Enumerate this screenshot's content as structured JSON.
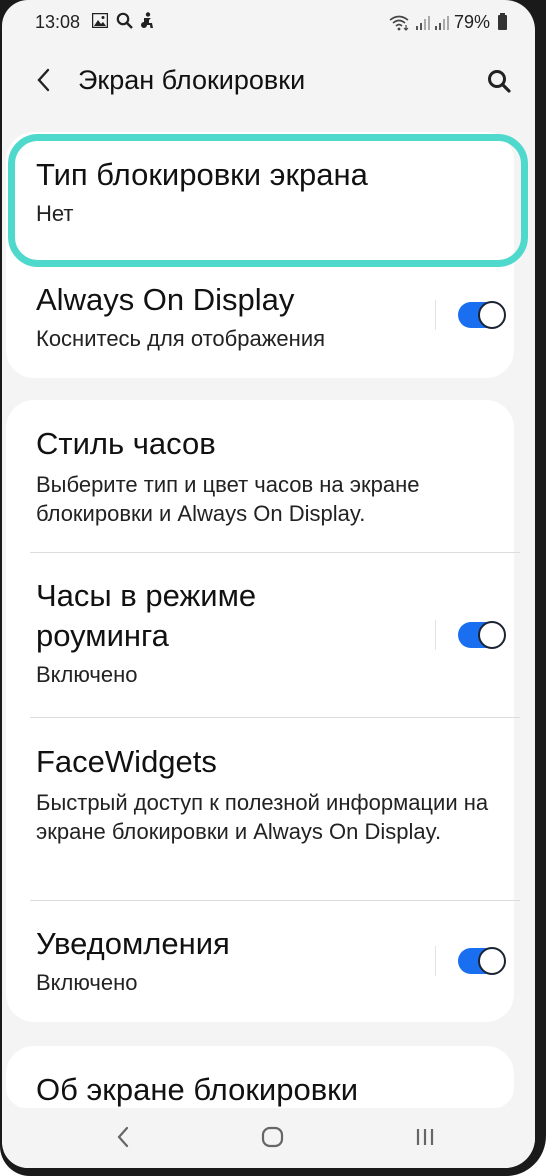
{
  "status_bar": {
    "time": "13:08",
    "left_icons": [
      "gallery-icon",
      "search-icon",
      "accessibility-icon"
    ],
    "right_icons": [
      "wifi-icon",
      "signal-icon",
      "signal-icon"
    ],
    "battery": "79%"
  },
  "header": {
    "title": "Экран блокировки",
    "back_icon": "chevron-left-icon",
    "search_icon": "search-icon"
  },
  "colors": {
    "accent": "#1a6ff1",
    "highlight": "#4fd8cc",
    "background": "#f4f4f4"
  },
  "groups": [
    {
      "items": [
        {
          "title": "Тип блокировки экрана",
          "subtitle": "Нет",
          "highlighted": true
        },
        {
          "title": "Always On Display",
          "subtitle": "Коснитесь для отображения",
          "toggle": true
        }
      ]
    },
    {
      "items": [
        {
          "title": "Стиль часов",
          "subtitle": "Выберите тип и цвет часов на экране блокировки и Always On Display."
        },
        {
          "title": "Часы в режиме роуминга",
          "subtitle": "Включено",
          "toggle": true
        },
        {
          "title": "FaceWidgets",
          "subtitle": "Быстрый доступ к полезной информации на экране блокировки и Always On Display."
        },
        {
          "title": "Уведомления",
          "subtitle": "Включено",
          "toggle": true
        }
      ]
    },
    {
      "items": [
        {
          "title": "Об экране блокировки"
        }
      ]
    }
  ],
  "nav_bar": {
    "back": "nav-back-icon",
    "home": "nav-home-icon",
    "recents": "nav-recents-icon"
  }
}
